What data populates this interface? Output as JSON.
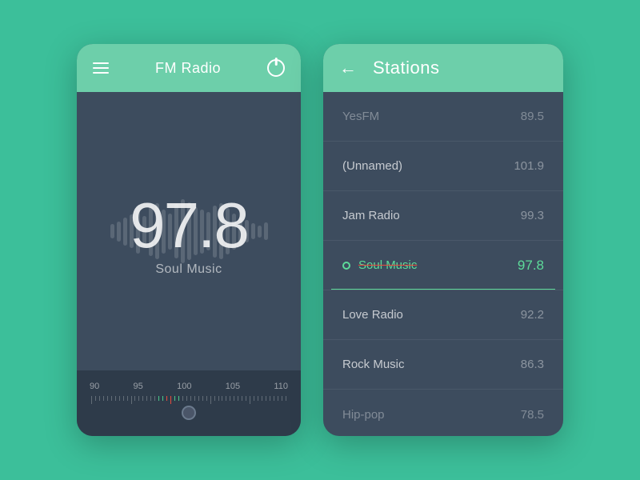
{
  "fm_radio": {
    "header": {
      "title": "FM Radio",
      "menu_label": "menu",
      "power_label": "power"
    },
    "frequency": "97.8",
    "station": "Soul Music",
    "tuner": {
      "labels": [
        "90",
        "95",
        "100",
        "105",
        "110"
      ]
    }
  },
  "stations": {
    "header": {
      "title": "Stations",
      "back_label": "back"
    },
    "list": [
      {
        "name": "YesFM",
        "freq": "89.5",
        "active": false,
        "dimmed": true
      },
      {
        "name": "(Unnamed)",
        "freq": "101.9",
        "active": false,
        "dimmed": false
      },
      {
        "name": "Jam Radio",
        "freq": "99.3",
        "active": false,
        "dimmed": false
      },
      {
        "name": "Soul Music",
        "freq": "97.8",
        "active": true,
        "dimmed": false
      },
      {
        "name": "Love Radio",
        "freq": "92.2",
        "active": false,
        "dimmed": false
      },
      {
        "name": "Rock Music",
        "freq": "86.3",
        "active": false,
        "dimmed": false
      },
      {
        "name": "Hip-pop",
        "freq": "78.5",
        "active": false,
        "dimmed": true
      }
    ]
  },
  "colors": {
    "bg": "#3cbf9a",
    "accent": "#6dcfaa",
    "active_green": "#5ddb9a",
    "card_bg": "#3d4c5e",
    "tuner_bg": "#2e3b4a"
  }
}
